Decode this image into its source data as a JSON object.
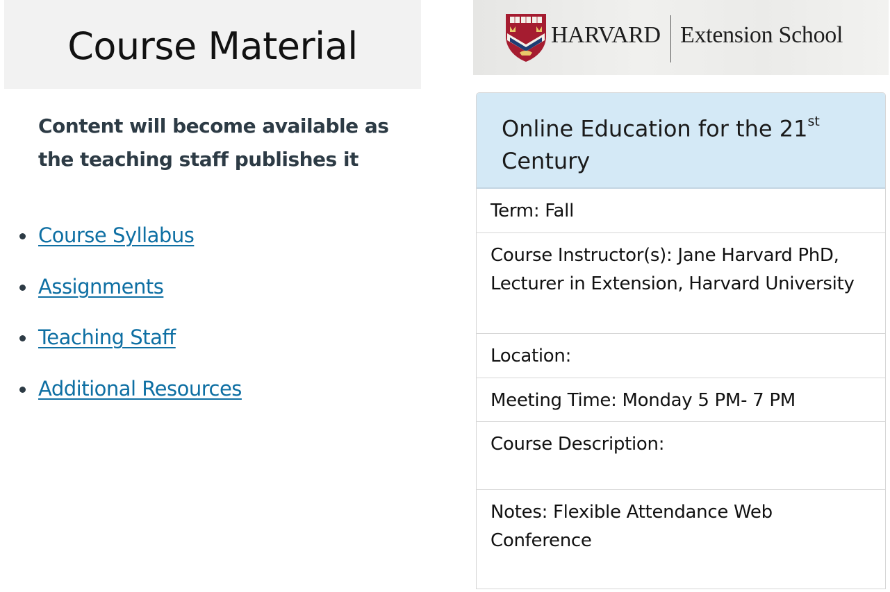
{
  "left": {
    "title": "Course Material",
    "intro": "Content will become available as the teaching staff publishes it",
    "links": [
      {
        "label": "Course Syllabus"
      },
      {
        "label": "Assignments"
      },
      {
        "label": "Teaching Staff"
      },
      {
        "label": "Additional Resources"
      }
    ]
  },
  "banner": {
    "brand_primary": "HARVARD",
    "brand_secondary": "Extension School",
    "logo_icon": "harvard-shield-icon",
    "shield_text": "VE RI TAS"
  },
  "course_info": {
    "title_main": "Online Education for the 21",
    "title_sup": "st",
    "title_end": "Century",
    "term": "Term: Fall",
    "instructor": "Course Instructor(s): Jane Harvard PhD, Lecturer in Extension, Harvard University",
    "location": "Location:",
    "meeting_time": "Meeting Time: Monday 5 PM- 7 PM",
    "description": "Course Description:",
    "notes": "Notes: Flexible Attendance Web Conference"
  },
  "colors": {
    "link": "#0e6fa3",
    "header_bg": "#f2f2f2",
    "info_title_bg": "#d4e9f6",
    "crimson": "#a51c30",
    "navy": "#1e3c73"
  }
}
